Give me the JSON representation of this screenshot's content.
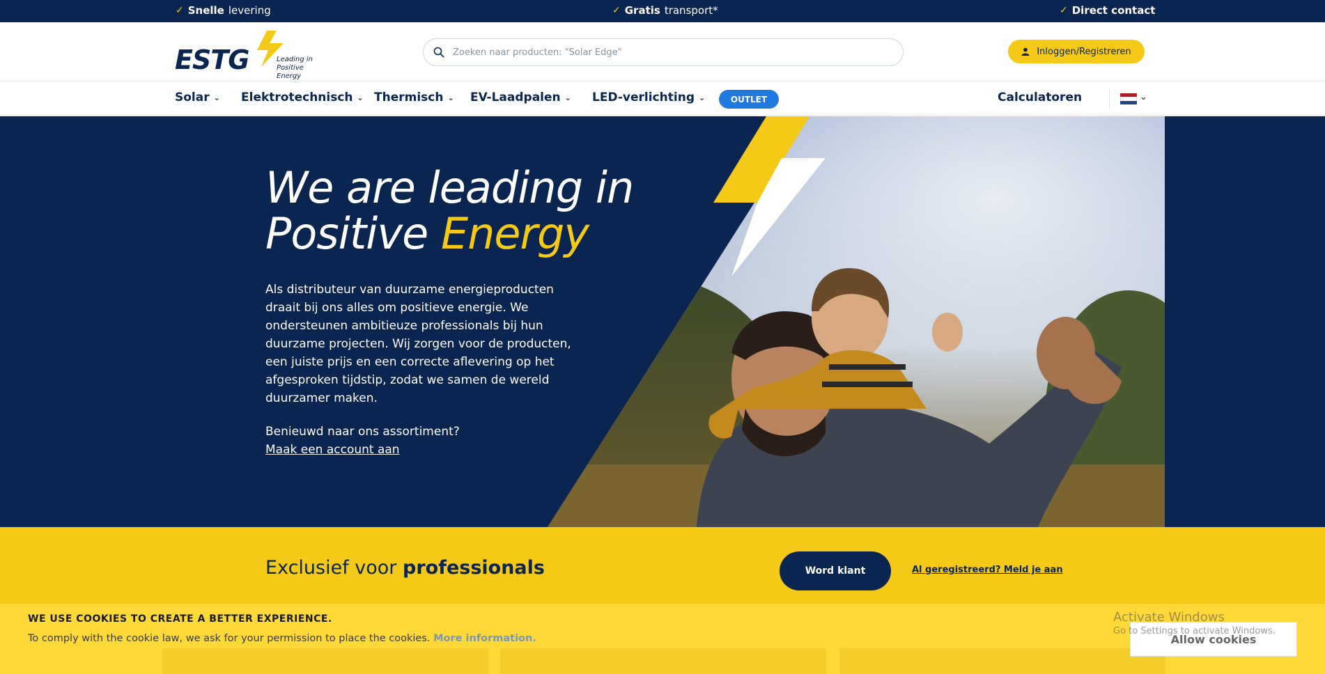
{
  "topbar": {
    "usp1_bold": "Snelle",
    "usp1_rest": "levering",
    "usp2_bold": "Gratis",
    "usp2_rest": "transport*",
    "usp3_bold": "Direct contact"
  },
  "header": {
    "logo_text": "ESTG",
    "logo_tagline_1": "Leading in",
    "logo_tagline_2": "Positive Energy",
    "search_placeholder": "Zoeken naar producten: \"Solar Edge\"",
    "login_label": "Inloggen/Registreren"
  },
  "nav": {
    "items": [
      {
        "label": "Solar"
      },
      {
        "label": "Elektrotechnisch"
      },
      {
        "label": "Thermisch"
      },
      {
        "label": "EV-Laadpalen"
      },
      {
        "label": "LED-verlichting"
      }
    ],
    "outlet_label": "OUTLET",
    "calculators_label": "Calculatoren",
    "language": "NL"
  },
  "hero": {
    "title_line1": "We are leading in",
    "title_line2_plain": "Positive ",
    "title_line2_highlight": "Energy",
    "description": "Als distributeur van duurzame energieproducten draait bij ons alles om positieve energie. We ondersteunen ambitieuze professionals bij hun duurzame projecten. Wij zorgen voor de producten, een juiste prijs en een correcte aflevering op het afgesproken tijdstip, zodat we samen de wereld duurzamer maken.",
    "question": "Benieuwd naar ons assortiment?",
    "link_label": "Maak een account aan"
  },
  "band": {
    "text_plain": "Exclusief voor ",
    "text_bold": "professionals",
    "cta_label": "Word klant",
    "already_label": "Al geregistreerd? Meld je aan"
  },
  "cookie": {
    "title": "WE USE COOKIES TO CREATE A BETTER EXPERIENCE.",
    "text": "To comply with the cookie law, we ask for your permission to place the cookies.",
    "more_label": "More information.",
    "allow_label": "Allow cookies"
  },
  "watermark": {
    "line1": "Activate Windows",
    "line2": "Go to Settings to activate Windows."
  },
  "colors": {
    "navy": "#0a2550",
    "yellow": "#f5c918",
    "outlet_blue": "#1f7ae0"
  }
}
